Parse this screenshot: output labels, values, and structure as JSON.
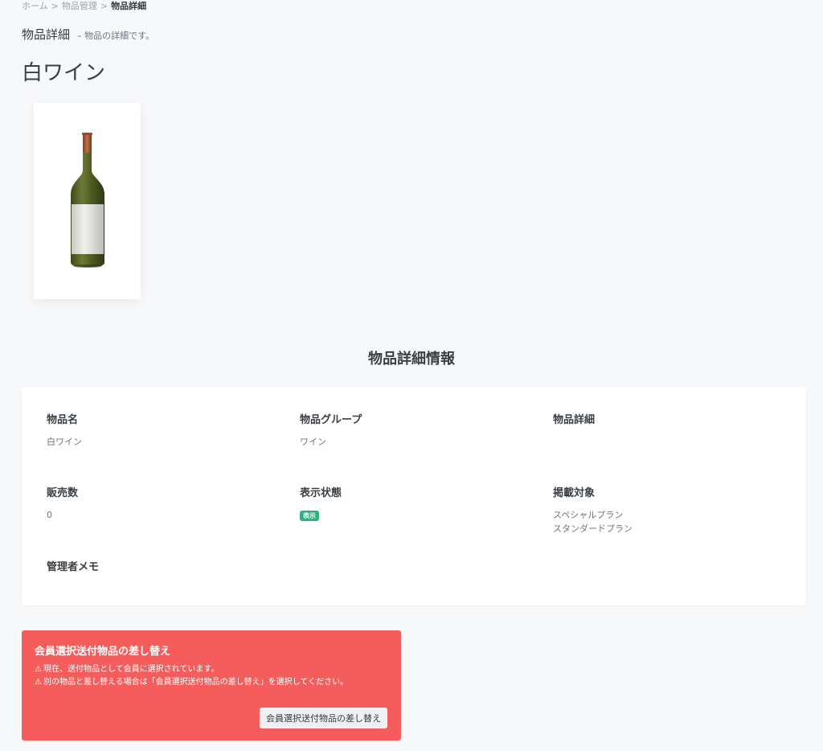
{
  "breadcrumb": {
    "home": "ホーム",
    "parent": "物品管理",
    "current": "物品詳細",
    "separator": ">"
  },
  "page_header": {
    "title": "物品詳細",
    "subtitle": "– 物品の詳細です。"
  },
  "item": {
    "name": "白ワイン",
    "image_icon": "wine-bottle-image"
  },
  "details": {
    "section_title": "物品詳細情報",
    "fields": {
      "name": {
        "label": "物品名",
        "value": "白ワイン"
      },
      "group": {
        "label": "物品グループ",
        "value": "ワイン"
      },
      "description": {
        "label": "物品詳細",
        "value": ""
      },
      "sales": {
        "label": "販売数",
        "value": "0"
      },
      "status": {
        "label": "表示状態",
        "value": "表示",
        "color": "#28b47c"
      },
      "targets": {
        "label": "掲載対象",
        "values": [
          "スペシャルプラン",
          "スタンダードプラン"
        ]
      },
      "memo": {
        "label": "管理者メモ",
        "value": ""
      }
    }
  },
  "alert": {
    "title": "会員選択送付物品の差し替え",
    "lines": [
      "現在、送付物品として会員に選択されています。",
      "別の物品と差し替える場合は「会員選択送付物品の差し替え」を選択してください。"
    ],
    "icon": "warning-icon",
    "button_label": "会員選択送付物品の差し替え",
    "color": "#f55d5d"
  }
}
